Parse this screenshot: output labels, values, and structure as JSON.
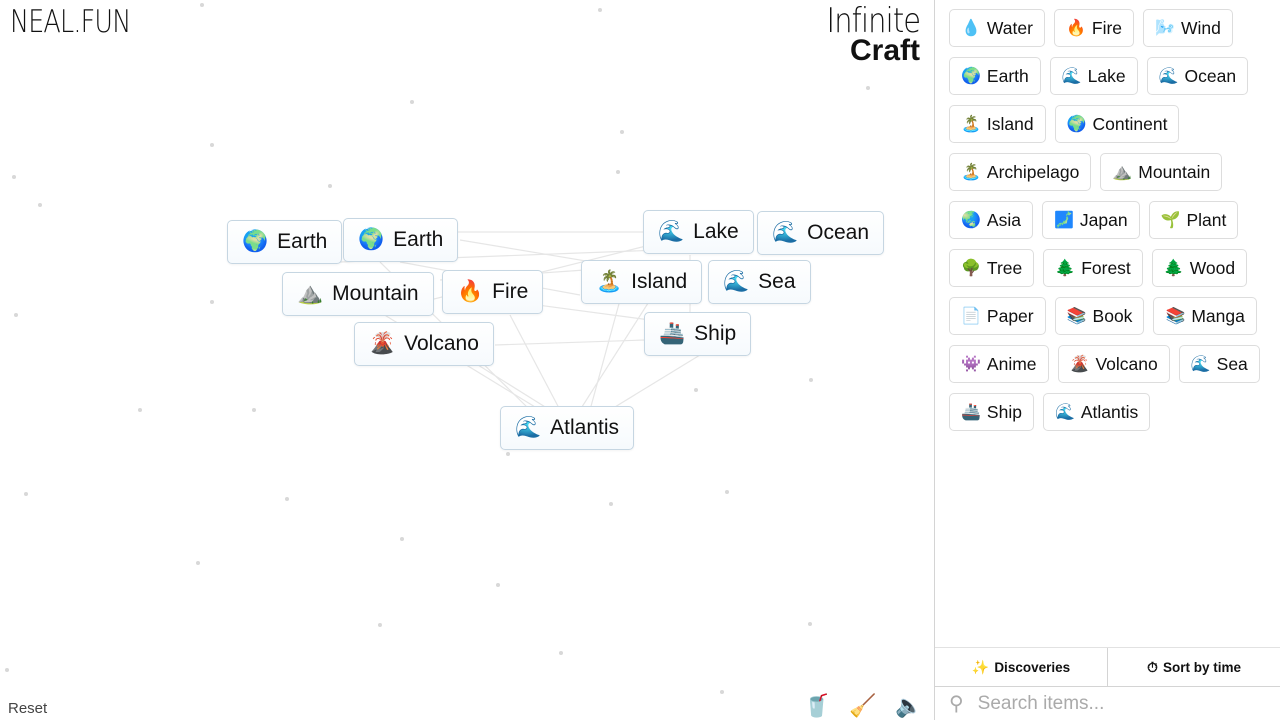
{
  "header": {
    "logo": "NEAL.FUN",
    "title_line1": "Infinite",
    "title_line2": "Craft"
  },
  "canvas": {
    "instances": [
      {
        "label": "Earth",
        "emoji": "🌍",
        "icon": "earth-icon"
      },
      {
        "label": "Earth",
        "emoji": "🌍",
        "icon": "earth-icon"
      },
      {
        "label": "Mountain",
        "emoji": "⛰️",
        "icon": "mountain-icon"
      },
      {
        "label": "Fire",
        "emoji": "🔥",
        "icon": "fire-icon"
      },
      {
        "label": "Volcano",
        "emoji": "🌋",
        "icon": "volcano-icon"
      },
      {
        "label": "Lake",
        "emoji": "🌊",
        "icon": "wave-icon"
      },
      {
        "label": "Ocean",
        "emoji": "🌊",
        "icon": "wave-icon"
      },
      {
        "label": "Island",
        "emoji": "🏝️",
        "icon": "island-icon"
      },
      {
        "label": "Sea",
        "emoji": "🌊",
        "icon": "wave-icon"
      },
      {
        "label": "Ship",
        "emoji": "🚢",
        "icon": "ship-icon"
      },
      {
        "label": "Atlantis",
        "emoji": "🌊",
        "icon": "wave-icon"
      }
    ],
    "reset_label": "Reset",
    "tools": [
      {
        "name": "donate-cup-icon",
        "glyph": "🥤"
      },
      {
        "name": "clear-broom-icon",
        "glyph": "🧹"
      },
      {
        "name": "sound-icon",
        "glyph": "🔈"
      }
    ]
  },
  "sidebar": {
    "items": [
      {
        "label": "Water",
        "emoji": "💧"
      },
      {
        "label": "Fire",
        "emoji": "🔥"
      },
      {
        "label": "Wind",
        "emoji": "🌬️"
      },
      {
        "label": "Earth",
        "emoji": "🌍"
      },
      {
        "label": "Lake",
        "emoji": "🌊"
      },
      {
        "label": "Ocean",
        "emoji": "🌊"
      },
      {
        "label": "Island",
        "emoji": "🏝️"
      },
      {
        "label": "Continent",
        "emoji": "🌍"
      },
      {
        "label": "Archipelago",
        "emoji": "🏝️"
      },
      {
        "label": "Mountain",
        "emoji": "⛰️"
      },
      {
        "label": "Asia",
        "emoji": "🌏"
      },
      {
        "label": "Japan",
        "emoji": "🗾"
      },
      {
        "label": "Plant",
        "emoji": "🌱"
      },
      {
        "label": "Tree",
        "emoji": "🌳"
      },
      {
        "label": "Forest",
        "emoji": "🌲"
      },
      {
        "label": "Wood",
        "emoji": "🌲"
      },
      {
        "label": "Paper",
        "emoji": "📄"
      },
      {
        "label": "Book",
        "emoji": "📚"
      },
      {
        "label": "Manga",
        "emoji": "📚"
      },
      {
        "label": "Anime",
        "emoji": "👾"
      },
      {
        "label": "Volcano",
        "emoji": "🌋"
      },
      {
        "label": "Sea",
        "emoji": "🌊"
      },
      {
        "label": "Ship",
        "emoji": "🚢"
      },
      {
        "label": "Atlantis",
        "emoji": "🌊"
      }
    ],
    "tabs": [
      {
        "label": "Discoveries",
        "icon": "✨"
      },
      {
        "label": "Sort by time",
        "icon": "⏱"
      }
    ],
    "search": {
      "placeholder": "Search items...",
      "value": ""
    }
  }
}
